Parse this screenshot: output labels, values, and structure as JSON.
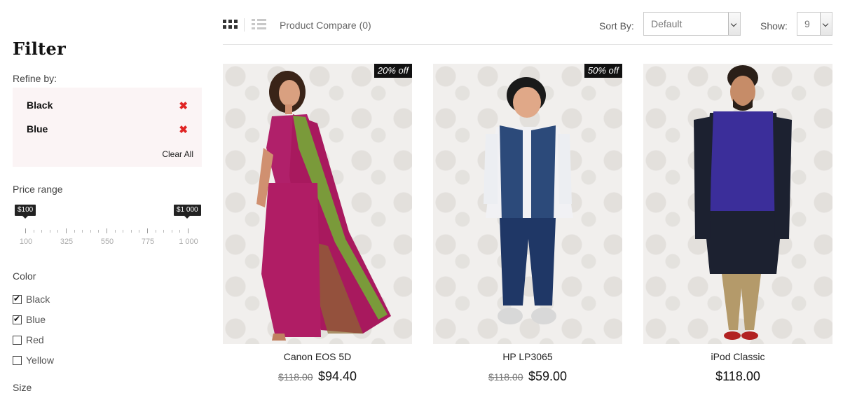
{
  "sidebar": {
    "title": "Filter",
    "refine_label": "Refine by:",
    "refine_items": [
      {
        "label": "Black"
      },
      {
        "label": "Blue"
      }
    ],
    "clear_all": "Clear All",
    "price_range": {
      "label": "Price range",
      "min_tag": "$100",
      "max_tag": "$1 000",
      "selected_min": 100,
      "selected_max": 1000,
      "tick_labels": [
        "100",
        "325",
        "550",
        "775",
        "1 000"
      ]
    },
    "color_label": "Color",
    "colors": [
      {
        "label": "Black",
        "checked": true
      },
      {
        "label": "Blue",
        "checked": true
      },
      {
        "label": "Red",
        "checked": false
      },
      {
        "label": "Yellow",
        "checked": false
      }
    ],
    "size_label": "Size"
  },
  "toolbar": {
    "compare_label": "Product Compare (0)",
    "sort_label": "Sort By:",
    "sort_value": "Default",
    "show_label": "Show:",
    "show_value": "9"
  },
  "products": [
    {
      "name": "Canon EOS 5D",
      "old_price": "$118.00",
      "price": "$94.40",
      "badge": "20% off"
    },
    {
      "name": "HP LP3065",
      "old_price": "$118.00",
      "price": "$59.00",
      "badge": "50% off"
    },
    {
      "name": "iPod Classic",
      "old_price": "",
      "price": "$118.00",
      "badge": ""
    }
  ],
  "colors": {
    "refine_bg": "#fbf4f5",
    "remove_x": "#e02424",
    "badge_bg": "#111111"
  }
}
